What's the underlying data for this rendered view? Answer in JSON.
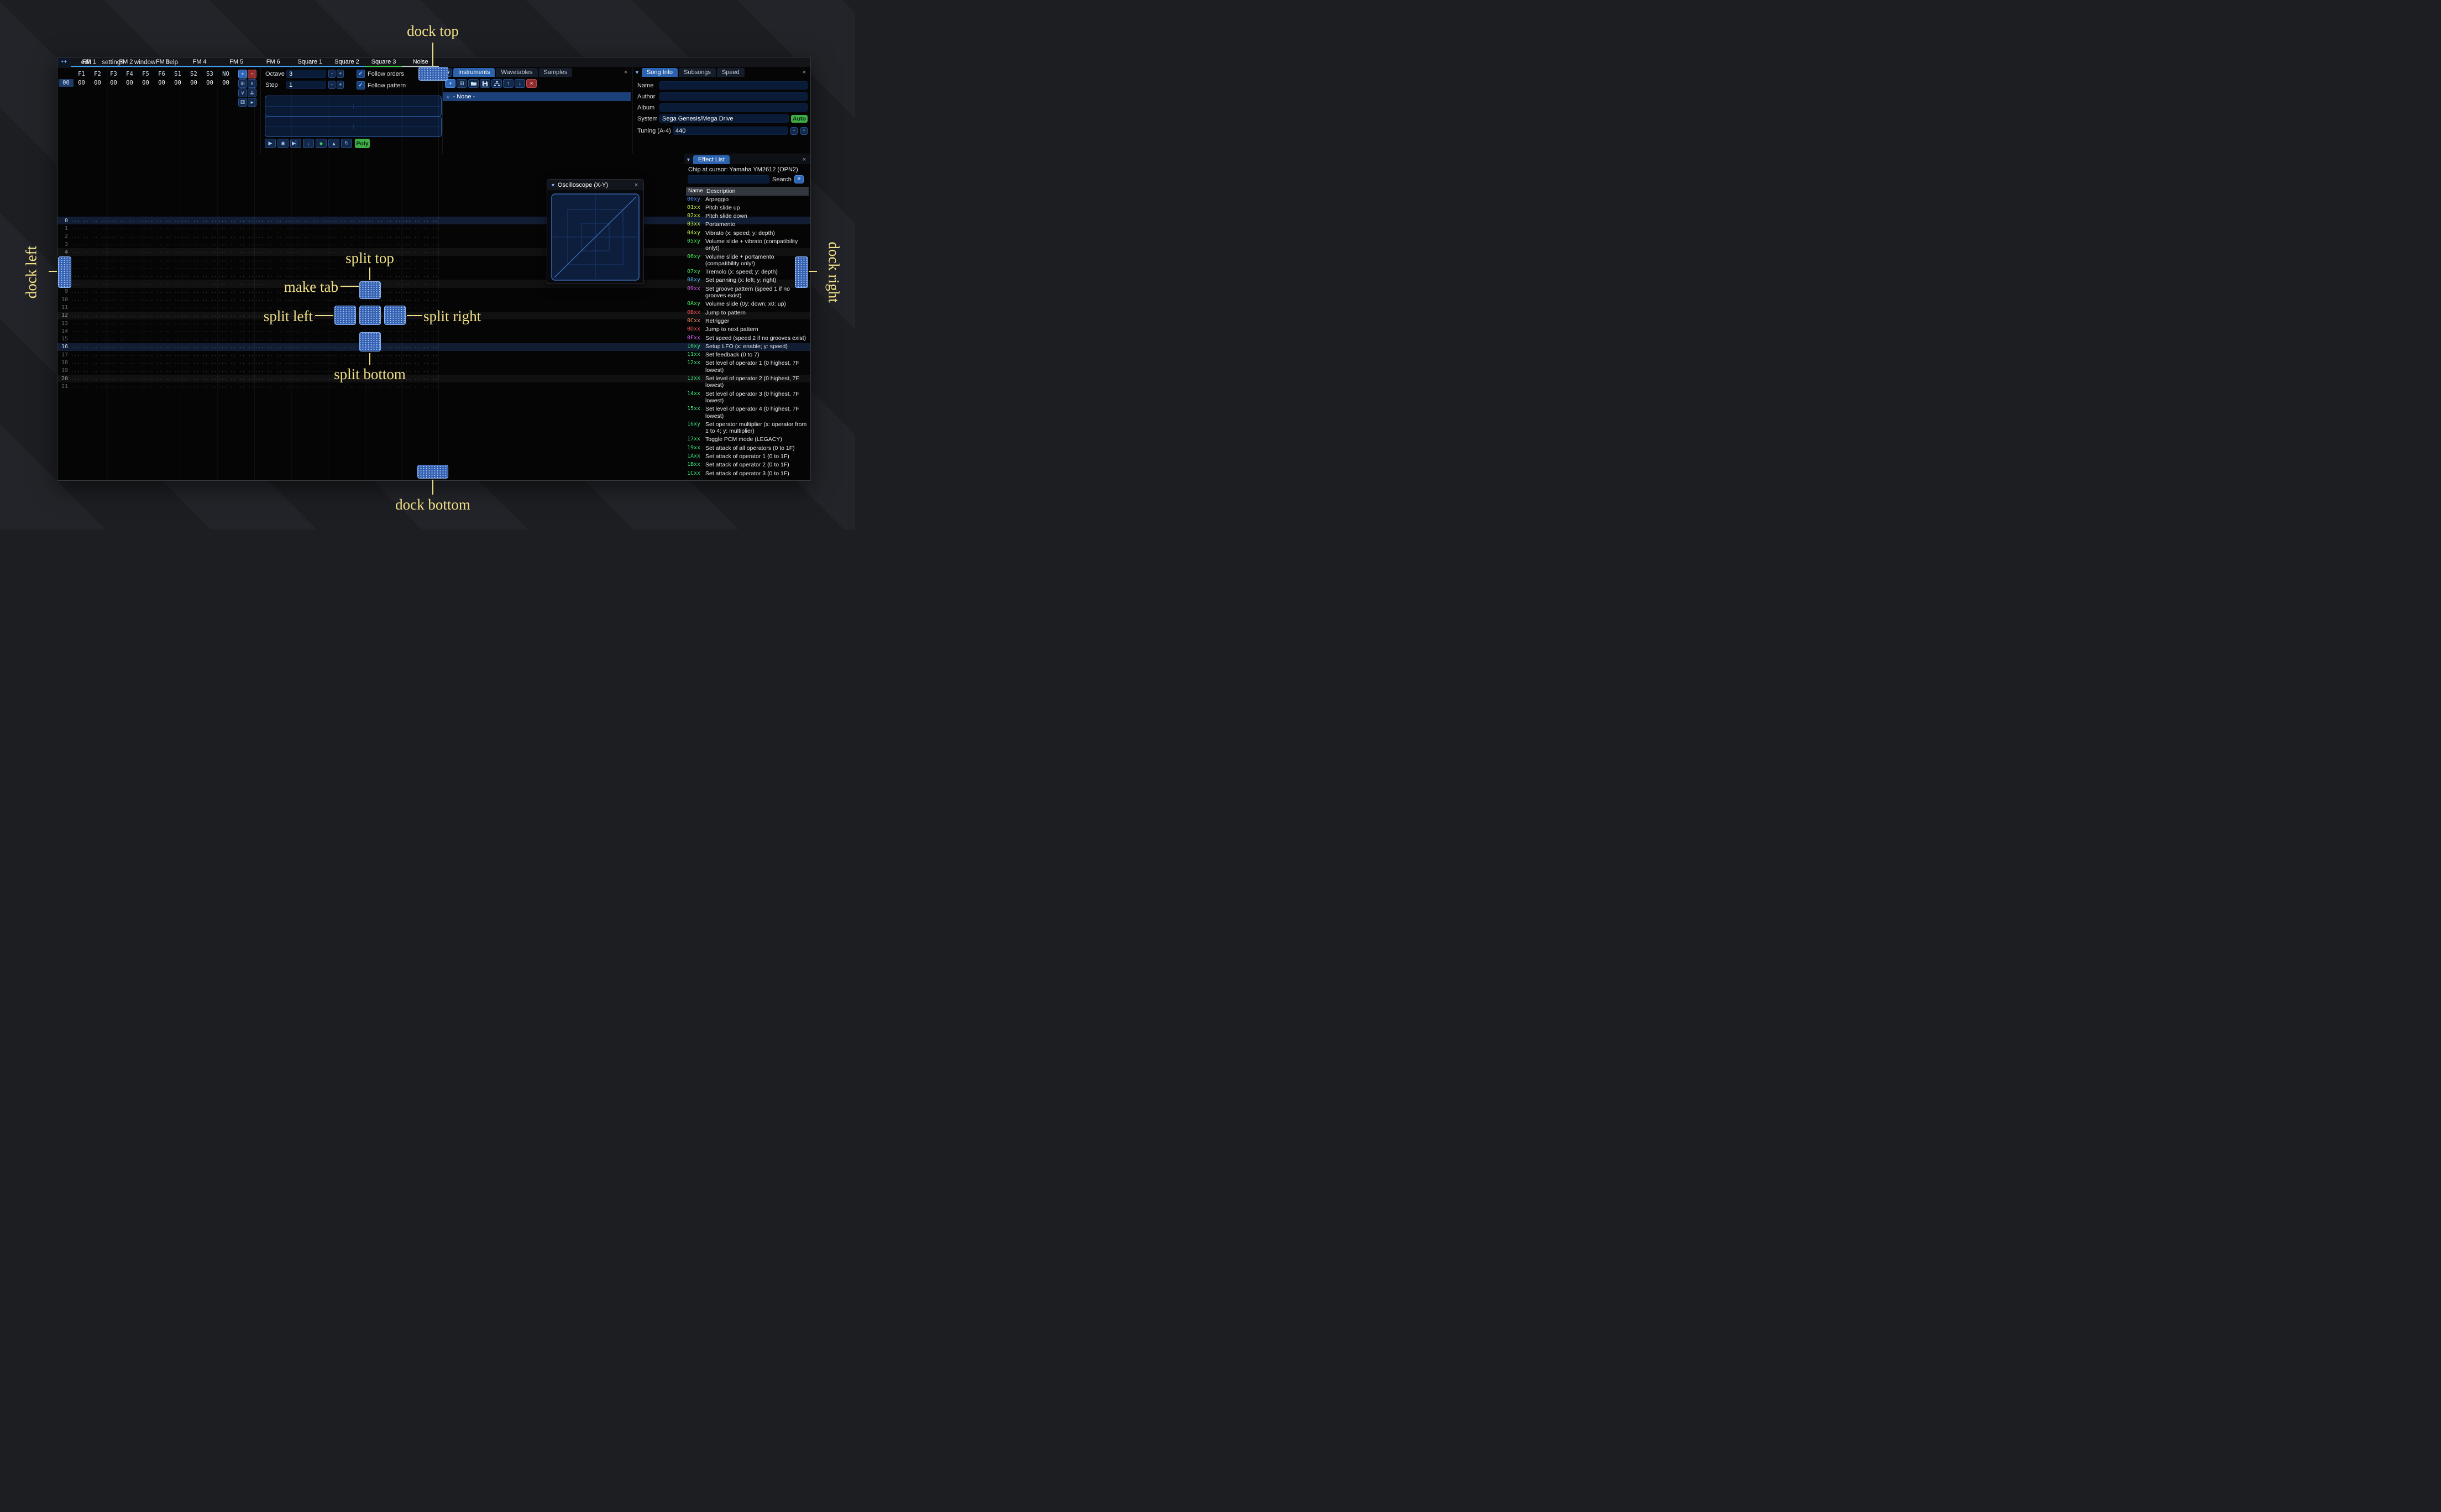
{
  "menu": {
    "items": [
      "file",
      "edit",
      "settings",
      "window",
      "help"
    ]
  },
  "orders": {
    "channels": [
      "F1",
      "F2",
      "F3",
      "F4",
      "F5",
      "F6",
      "S1",
      "S2",
      "S3",
      "NO"
    ],
    "row_label": "00",
    "row_values": [
      "00",
      "00",
      "00",
      "00",
      "00",
      "00",
      "00",
      "00",
      "00",
      "00"
    ],
    "buttons": [
      {
        "name": "order-add-button",
        "glyph": "+",
        "style": "primary"
      },
      {
        "name": "order-remove-button",
        "glyph": "−",
        "style": "danger"
      },
      {
        "name": "order-duplicate-button",
        "glyph": "⊞",
        "style": ""
      },
      {
        "name": "order-move-up-button",
        "glyph": "∧",
        "style": ""
      },
      {
        "name": "order-move-down-button",
        "glyph": "∨",
        "style": ""
      },
      {
        "name": "order-duplicate-end-button",
        "glyph": "⇊",
        "style": ""
      },
      {
        "name": "order-randomize-button",
        "glyph": "⚄",
        "style": ""
      },
      {
        "name": "order-edit-mode-button",
        "glyph": "▸",
        "style": ""
      }
    ]
  },
  "transport": {
    "octave_label": "Octave",
    "octave_value": "3",
    "step_label": "Step",
    "step_value": "1",
    "follow_orders": "Follow orders",
    "follow_pattern": "Follow pattern",
    "poly_label": "Poly",
    "playback": [
      {
        "name": "play-button",
        "glyph": "▶"
      },
      {
        "name": "play-repeat-button",
        "glyph": "◉"
      },
      {
        "name": "play-from-cursor-button",
        "glyph": "▶▏"
      },
      {
        "name": "step-one-row-button",
        "glyph": "↓"
      },
      {
        "name": "edit-record-button",
        "glyph": "●"
      },
      {
        "name": "metronome-button",
        "glyph": "▲"
      },
      {
        "name": "repeat-pattern-button",
        "glyph": "↻"
      }
    ]
  },
  "instruments_panel": {
    "tabs": [
      "Instruments",
      "Wavetables",
      "Samples"
    ],
    "active_tab": "Instruments",
    "toolbar_glyphs": {
      "add": "+",
      "duplicate": "⊞",
      "up": "↑",
      "down": "↓",
      "remove": "×"
    },
    "toolbar_icons": [
      "folder-open-icon",
      "save-icon",
      "sitemap-icon"
    ],
    "list": [
      {
        "label": "- None -",
        "selected": true
      }
    ]
  },
  "song_info": {
    "tabs": [
      "Song Info",
      "Subsongs",
      "Speed"
    ],
    "active_tab": "Song Info",
    "fields": [
      {
        "label": "Name",
        "value": ""
      },
      {
        "label": "Author",
        "value": ""
      },
      {
        "label": "Album",
        "value": ""
      }
    ],
    "system_label": "System",
    "system_value": "Sega Genesis/Mega Drive",
    "auto_label": "Auto",
    "tuning_label": "Tuning (A-4)",
    "tuning_value": "440"
  },
  "pattern": {
    "corner_label": "++",
    "rows_visible": 22,
    "empty_cell": "... .. .. ....",
    "channels": [
      {
        "name": "FM 1",
        "color": "#38a0f5"
      },
      {
        "name": "FM 2",
        "color": "#38a0f5"
      },
      {
        "name": "FM 3",
        "color": "#38a0f5"
      },
      {
        "name": "FM 4",
        "color": "#38a0f5"
      },
      {
        "name": "FM 5",
        "color": "#38a0f5"
      },
      {
        "name": "FM 6",
        "color": "#38a0f5"
      },
      {
        "name": "Square 1",
        "color": "#38a0f5"
      },
      {
        "name": "Square 2",
        "color": "#38a0f5"
      },
      {
        "name": "Square 3",
        "color": "#2ecc40"
      },
      {
        "name": "Noise",
        "color": "#c3c8cf"
      }
    ]
  },
  "oscilloscope": {
    "title": "Oscilloscope (X-Y)"
  },
  "effect_list": {
    "title": "Effect List",
    "chip_label": "Chip at cursor: Yamaha YM2612 (OPN2)",
    "search_label": "Search",
    "columns": {
      "name": "Name",
      "description": "Description"
    },
    "effects": [
      {
        "code": "00xy",
        "desc": "Arpeggio",
        "color": "#4f8df2"
      },
      {
        "code": "01xx",
        "desc": "Pitch slide up",
        "color": "#c7f245"
      },
      {
        "code": "02xx",
        "desc": "Pitch slide down",
        "color": "#c7f245"
      },
      {
        "code": "03xx",
        "desc": "Portamento",
        "color": "#c7f245"
      },
      {
        "code": "04xy",
        "desc": "Vibrato (x: speed; y: depth)",
        "color": "#c7f245"
      },
      {
        "code": "05xy",
        "desc": "Volume slide + vibrato (compatibility only!)",
        "color": "#42e855"
      },
      {
        "code": "06xy",
        "desc": "Volume slide + portamento (compatibility only!)",
        "color": "#42e855"
      },
      {
        "code": "07xy",
        "desc": "Tremolo (x: speed; y: depth)",
        "color": "#42e855"
      },
      {
        "code": "08xy",
        "desc": "Set panning (x: left; y: right)",
        "color": "#4fb2f2"
      },
      {
        "code": "09xx",
        "desc": "Set groove pattern (speed 1 if no grooves exist)",
        "color": "#d75cf0"
      },
      {
        "code": "0Axy",
        "desc": "Volume slide (0y: down; x0: up)",
        "color": "#42e855"
      },
      {
        "code": "0Bxx",
        "desc": "Jump to pattern",
        "color": "#f25555"
      },
      {
        "code": "0Cxx",
        "desc": "Retrigger",
        "color": "#f0914f"
      },
      {
        "code": "0Dxx",
        "desc": "Jump to next pattern",
        "color": "#f25555"
      },
      {
        "code": "0Fxx",
        "desc": "Set speed (speed 2 if no grooves exist)",
        "color": "#d75cf0"
      },
      {
        "code": "10xy",
        "desc": "Setup LFO (x: enable; y: speed)",
        "color": "#3ce87d"
      },
      {
        "code": "11xx",
        "desc": "Set feedback (0 to 7)",
        "color": "#3ce87d"
      },
      {
        "code": "12xx",
        "desc": "Set level of operator 1 (0 highest, 7F lowest)",
        "color": "#3ce87d"
      },
      {
        "code": "13xx",
        "desc": "Set level of operator 2 (0 highest, 7F lowest)",
        "color": "#3ce87d"
      },
      {
        "code": "14xx",
        "desc": "Set level of operator 3 (0 highest, 7F lowest)",
        "color": "#3ce87d"
      },
      {
        "code": "15xx",
        "desc": "Set level of operator 4 (0 highest, 7F lowest)",
        "color": "#3ce87d"
      },
      {
        "code": "16xy",
        "desc": "Set operator multiplier (x: operator from 1 to 4; y: multiplier)",
        "color": "#3ce87d"
      },
      {
        "code": "17xx",
        "desc": "Toggle PCM mode (LEGACY)",
        "color": "#3ce87d"
      },
      {
        "code": "19xx",
        "desc": "Set attack of all operators (0 to 1F)",
        "color": "#3ce87d"
      },
      {
        "code": "1Axx",
        "desc": "Set attack of operator 1 (0 to 1F)",
        "color": "#3ce87d"
      },
      {
        "code": "1Bxx",
        "desc": "Set attack of operator 2 (0 to 1F)",
        "color": "#3ce87d"
      },
      {
        "code": "1Cxx",
        "desc": "Set attack of operator 3 (0 to 1F)",
        "color": "#3ce87d"
      }
    ]
  },
  "dock_overlay": {
    "labels": {
      "top": "dock top",
      "bottom": "dock bottom",
      "left": "dock left",
      "right": "dock right",
      "make_tab": "make tab",
      "split_top": "split top",
      "split_left": "split left",
      "split_right": "split right",
      "split_bottom": "split bottom"
    },
    "accent_color": "#f1e186",
    "target_color": "#3a6cc4"
  },
  "ui": {
    "close_glyph": "×",
    "collapse_glyph": "▼",
    "tab_list_glyph": "▼",
    "check_glyph": "✓",
    "radio_glyph": "○",
    "minus_glyph": "-",
    "plus_glyph": "+",
    "menu_glyph": "≡",
    "corner_glyph": "++"
  }
}
